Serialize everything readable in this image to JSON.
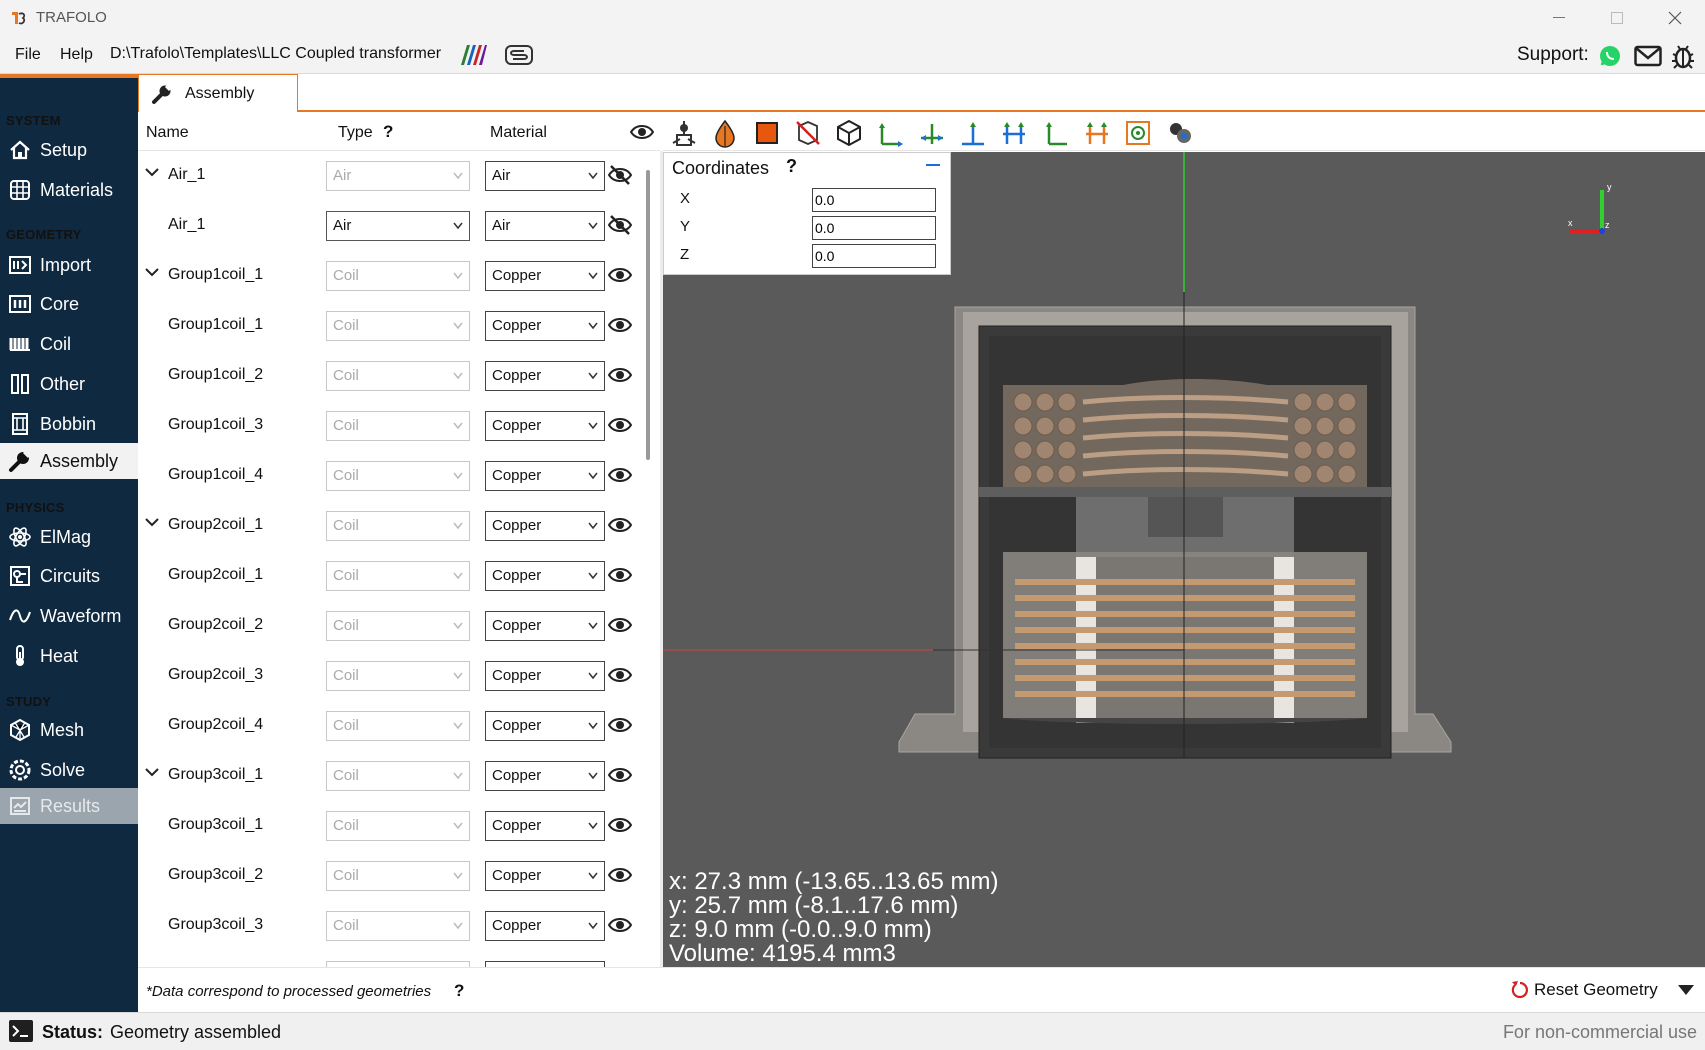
{
  "window": {
    "title": "TRAFOLO"
  },
  "menu": {
    "file": "File",
    "help": "Help",
    "path": "D:\\Trafolo\\Templates\\LLC Coupled transformer",
    "support": "Support:"
  },
  "sidebar": {
    "sections": [
      "SYSTEM",
      "GEOMETRY",
      "PHYSICS",
      "STUDY"
    ],
    "items": [
      {
        "label": "Setup",
        "icon": "house-icon"
      },
      {
        "label": "Materials",
        "icon": "grid-icon"
      },
      {
        "label": "Import",
        "icon": "import-icon"
      },
      {
        "label": "Core",
        "icon": "core-icon"
      },
      {
        "label": "Coil",
        "icon": "coil-icon"
      },
      {
        "label": "Other",
        "icon": "other-icon"
      },
      {
        "label": "Bobbin",
        "icon": "bobbin-icon"
      },
      {
        "label": "Assembly",
        "icon": "wrench-icon",
        "active": true
      },
      {
        "label": "ElMag",
        "icon": "atom-icon"
      },
      {
        "label": "Circuits",
        "icon": "circuit-icon"
      },
      {
        "label": "Waveform",
        "icon": "wave-icon"
      },
      {
        "label": "Heat",
        "icon": "thermometer-icon"
      },
      {
        "label": "Mesh",
        "icon": "mesh-icon"
      },
      {
        "label": "Solve",
        "icon": "solve-icon"
      },
      {
        "label": "Results",
        "icon": "results-icon",
        "disabled": true
      }
    ]
  },
  "tab": {
    "label": "Assembly"
  },
  "table": {
    "headers": {
      "name": "Name",
      "type": "Type",
      "type_help": "?",
      "material": "Material"
    },
    "rows": [
      {
        "name": "Air_1",
        "group": true,
        "type": "Air",
        "material": "Air",
        "hidden": true
      },
      {
        "name": "Air_1",
        "group": false,
        "type": "Air",
        "material": "Air",
        "hidden": true,
        "type_enabled": true
      },
      {
        "name": "Group1coil_1",
        "group": true,
        "type": "Coil",
        "material": "Copper"
      },
      {
        "name": "Group1coil_1",
        "group": false,
        "type": "Coil",
        "material": "Copper"
      },
      {
        "name": "Group1coil_2",
        "group": false,
        "type": "Coil",
        "material": "Copper"
      },
      {
        "name": "Group1coil_3",
        "group": false,
        "type": "Coil",
        "material": "Copper"
      },
      {
        "name": "Group1coil_4",
        "group": false,
        "type": "Coil",
        "material": "Copper"
      },
      {
        "name": "Group2coil_1",
        "group": true,
        "type": "Coil",
        "material": "Copper"
      },
      {
        "name": "Group2coil_1",
        "group": false,
        "type": "Coil",
        "material": "Copper"
      },
      {
        "name": "Group2coil_2",
        "group": false,
        "type": "Coil",
        "material": "Copper"
      },
      {
        "name": "Group2coil_3",
        "group": false,
        "type": "Coil",
        "material": "Copper"
      },
      {
        "name": "Group2coil_4",
        "group": false,
        "type": "Coil",
        "material": "Copper"
      },
      {
        "name": "Group3coil_1",
        "group": true,
        "type": "Coil",
        "material": "Copper"
      },
      {
        "name": "Group3coil_1",
        "group": false,
        "type": "Coil",
        "material": "Copper"
      },
      {
        "name": "Group3coil_2",
        "group": false,
        "type": "Coil",
        "material": "Copper"
      },
      {
        "name": "Group3coil_3",
        "group": false,
        "type": "Coil",
        "material": "Copper"
      }
    ]
  },
  "coordinates": {
    "title": "Coordinates",
    "help": "?",
    "x_label": "X",
    "y_label": "Y",
    "z_label": "Z",
    "x": "0.0",
    "y": "0.0",
    "z": "0.0"
  },
  "dimensions": {
    "x": "x: 27.3 mm (-13.65..13.65 mm)",
    "y": "y: 25.7 mm (-8.1..17.6 mm)",
    "z": "z: 9.0 mm (-0.0..9.0 mm)",
    "volume": "Volume: 4195.4 mm3"
  },
  "triad": {
    "x": "x",
    "y": "y",
    "z": "z"
  },
  "footer": {
    "note": "*Data correspond to processed geometries",
    "help": "?",
    "reset": "Reset Geometry"
  },
  "status": {
    "label": "Status:",
    "text": "Geometry assembled",
    "license": "For non-commercial use"
  },
  "colors": {
    "accent": "#e87722",
    "sidebar": "#0f2940",
    "viewport": "#5a5a5a"
  }
}
